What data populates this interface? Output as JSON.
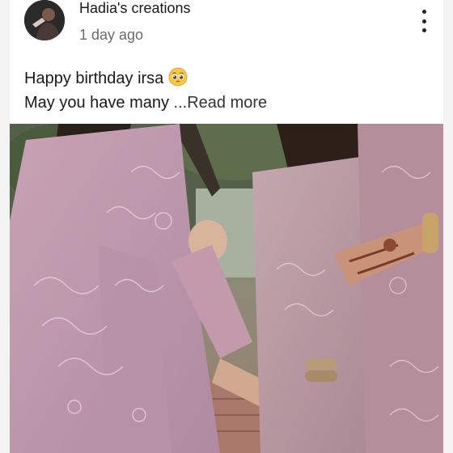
{
  "post": {
    "channel_name": "Hadia's creations",
    "time_ago": "1 day ago",
    "text_line1": "Happy birthday irsa",
    "text_line2": "May you have many",
    "read_more": "...Read more",
    "emoji_name": "pleading-face-emoji",
    "menu_icon": "more-vert-icon"
  },
  "colors": {
    "card_bg": "#ffffff",
    "page_bg": "#f3f3f3",
    "text_primary": "#1a1a1a",
    "text_secondary": "#6b6b6b"
  }
}
